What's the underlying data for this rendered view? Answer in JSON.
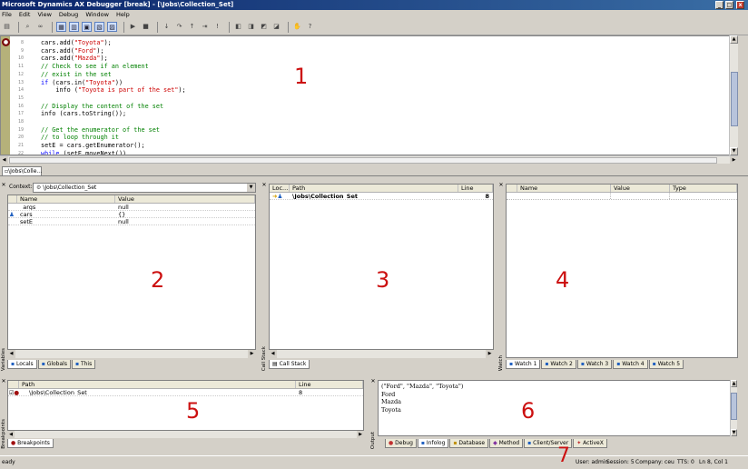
{
  "window": {
    "title": "Microsoft Dynamics AX Debugger [break] - [\\Jobs\\Collection_Set]"
  },
  "menu": [
    "File",
    "Edit",
    "View",
    "Debug",
    "Window",
    "Help"
  ],
  "code": {
    "lines": [
      {
        "num": "8",
        "text": [
          {
            "t": "cars.add(",
            "c": ""
          },
          {
            "t": "\"Toyota\"",
            "c": "str"
          },
          {
            "t": ");",
            "c": ""
          }
        ]
      },
      {
        "num": "9",
        "text": [
          {
            "t": "cars.add(",
            "c": ""
          },
          {
            "t": "\"Ford\"",
            "c": "str"
          },
          {
            "t": ");",
            "c": ""
          }
        ]
      },
      {
        "num": "10",
        "text": [
          {
            "t": "cars.add(",
            "c": ""
          },
          {
            "t": "\"Mazda\"",
            "c": "str"
          },
          {
            "t": ");",
            "c": ""
          }
        ]
      },
      {
        "num": "11",
        "text": [
          {
            "t": "// Check to see if an element",
            "c": "cmt"
          }
        ]
      },
      {
        "num": "12",
        "text": [
          {
            "t": "// exist in the set",
            "c": "cmt"
          }
        ]
      },
      {
        "num": "13",
        "text": [
          {
            "t": "if",
            "c": "kw"
          },
          {
            "t": " (cars.in(",
            "c": ""
          },
          {
            "t": "\"Toyota\"",
            "c": "str"
          },
          {
            "t": "))",
            "c": ""
          }
        ]
      },
      {
        "num": "14",
        "text": [
          {
            "t": "    info (",
            "c": ""
          },
          {
            "t": "\"Toyota is part of the set\"",
            "c": "str"
          },
          {
            "t": ");",
            "c": ""
          }
        ]
      },
      {
        "num": "15",
        "text": [
          {
            "t": "",
            "c": ""
          }
        ]
      },
      {
        "num": "16",
        "text": [
          {
            "t": "// Display the content of the set",
            "c": "cmt"
          }
        ]
      },
      {
        "num": "17",
        "text": [
          {
            "t": "info (cars.toString());",
            "c": ""
          }
        ]
      },
      {
        "num": "18",
        "text": [
          {
            "t": "",
            "c": ""
          }
        ]
      },
      {
        "num": "19",
        "text": [
          {
            "t": "// Get the enumerator of the set",
            "c": "cmt"
          }
        ]
      },
      {
        "num": "20",
        "text": [
          {
            "t": "// to loop through it",
            "c": "cmt"
          }
        ]
      },
      {
        "num": "21",
        "text": [
          {
            "t": "setE = cars.getEnumerator();",
            "c": ""
          }
        ]
      },
      {
        "num": "22",
        "text": [
          {
            "t": "while",
            "c": "kw"
          },
          {
            "t": " (setE.moveNext())",
            "c": ""
          }
        ]
      }
    ]
  },
  "editor_tab": "\\Jobs\\Colle...",
  "variables": {
    "context_label": "Context:",
    "context_value": "\\Jobs\\Collection_Set",
    "col_name": "Name",
    "col_value": "Value",
    "rows": [
      {
        "name": "_args",
        "value": "null"
      },
      {
        "name": "cars",
        "value": "{}"
      },
      {
        "name": "setE",
        "value": "null"
      }
    ],
    "tabs": [
      "Locals",
      "Globals",
      "This"
    ],
    "side_label": "Variables"
  },
  "callstack": {
    "col_loc": "Loc...",
    "col_path": "Path",
    "col_line": "Line",
    "rows": [
      {
        "path": "\\Jobs\\Collection_Set",
        "line": "8"
      }
    ],
    "tabs": [
      "Call Stack"
    ],
    "side_label": "Call Stack"
  },
  "watch": {
    "col_name": "Name",
    "col_value": "Value",
    "col_type": "Type",
    "tabs": [
      "Watch 1",
      "Watch 2",
      "Watch 3",
      "Watch 4",
      "Watch 5"
    ],
    "side_label": "Watch"
  },
  "breakpoints": {
    "col_path": "Path",
    "col_line": "Line",
    "rows": [
      {
        "path": "\\Jobs\\Collection_Set",
        "line": "8"
      }
    ],
    "tabs": [
      "Breakpoints"
    ],
    "side_label": "Breakpoints"
  },
  "output": {
    "lines": [
      "(\"Ford\", \"Mazda\", \"Toyota\")",
      "Ford",
      "Mazda",
      "Toyota"
    ],
    "tabs": [
      "Debug",
      "Infolog",
      "Database",
      "Method",
      "Client/Server",
      "ActiveX"
    ],
    "side_label": "Output"
  },
  "status": {
    "left": "eady",
    "user": "User: admin",
    "session": "Session: 5",
    "company": "Company: ceu",
    "tts": "TTS: 0",
    "position": "Ln 8, Col 1"
  },
  "annotations": [
    "1",
    "2",
    "3",
    "4",
    "5",
    "6",
    "7"
  ]
}
